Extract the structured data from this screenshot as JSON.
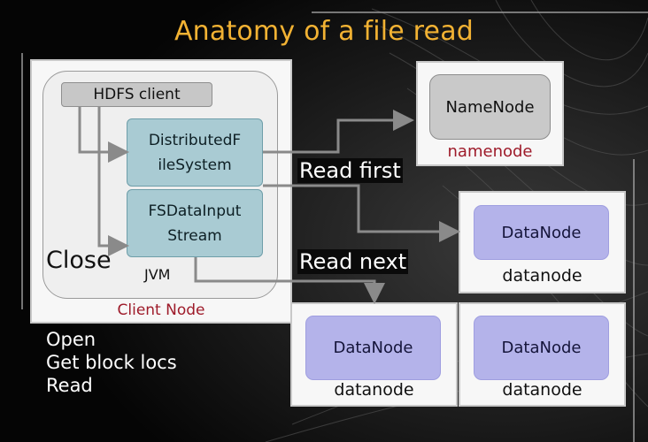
{
  "title": "Anatomy of a file read",
  "client_node": {
    "label": "Client Node",
    "hdfs_client": "HDFS client",
    "dfs_lines": [
      "DistributedF",
      "ileSystem"
    ],
    "fsdis_lines": [
      "FSDataInput",
      "Stream"
    ],
    "close_label": "Close",
    "jvm_label": "JVM"
  },
  "namenode": {
    "box_label": "NameNode",
    "node_label": "namenode"
  },
  "datanodes": [
    {
      "box_label": "DataNode",
      "node_label": "datanode"
    },
    {
      "box_label": "DataNode",
      "node_label": "datanode"
    },
    {
      "box_label": "DataNode",
      "node_label": "datanode"
    }
  ],
  "arrow_labels": {
    "read_first": "Read first",
    "read_next": "Read next"
  },
  "steps": [
    "Open",
    "Get block locs",
    "Read"
  ],
  "colors": {
    "title": "#f2b233",
    "client_node_label": "#9e1b2a",
    "teal_box": "#a9cbd3",
    "datanode_box": "#b4b3ea",
    "arrow": "#8a8a8a"
  }
}
